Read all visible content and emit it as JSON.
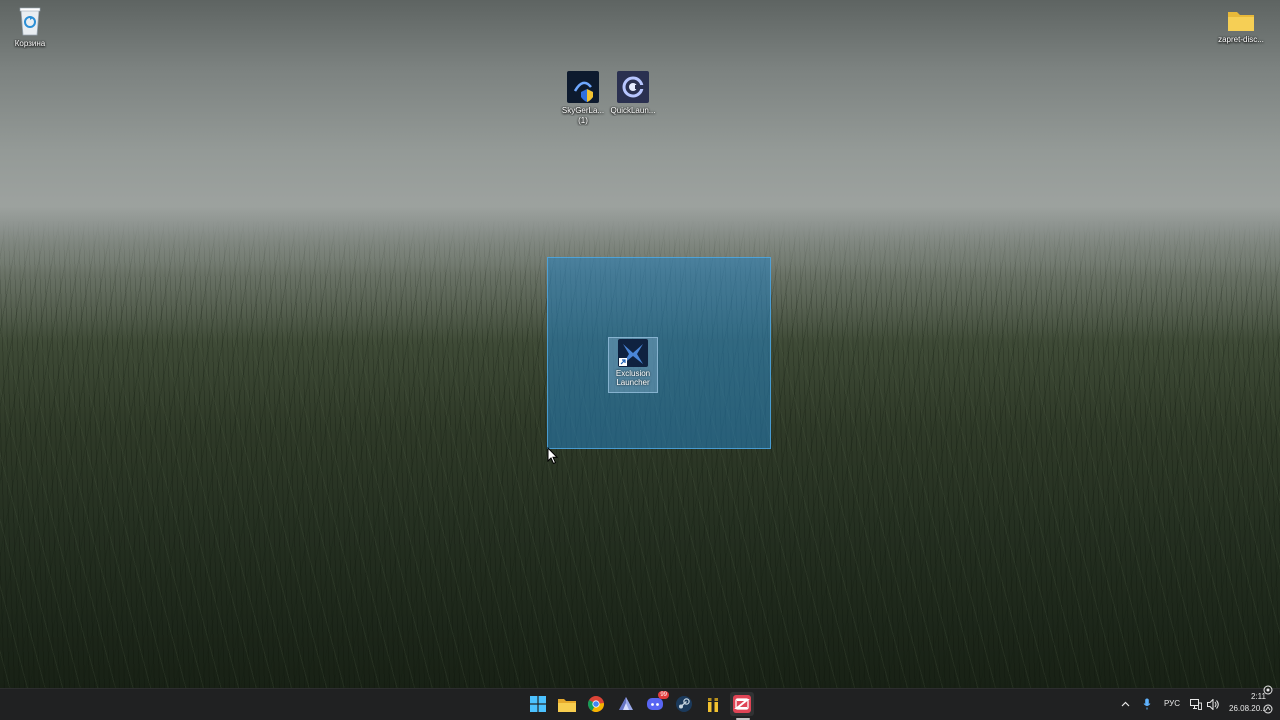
{
  "desktop": {
    "recycle_bin_label": "Корзина",
    "folder_label": "zapret-disc...",
    "skyger_label_line1": "SkyGerLa...",
    "skyger_label_line2": "(1)",
    "quick_label": "QuickLaun...",
    "exclusion_label_line1": "Exclusion",
    "exclusion_label_line2": "Launcher"
  },
  "taskbar": {
    "apps": [
      "start-icon",
      "file-explorer-icon",
      "chrome-icon",
      "prism-launcher-icon",
      "discord-icon",
      "steam-icon",
      "game-launcher-icon",
      "capcut-icon"
    ],
    "discord_badge": "99",
    "tray": {
      "language": "РУС",
      "time": "2:11",
      "date": "26.08.20..."
    }
  },
  "colors": {
    "selection": "#2682be",
    "taskbar": "#202122",
    "folder": "#f3c744"
  }
}
